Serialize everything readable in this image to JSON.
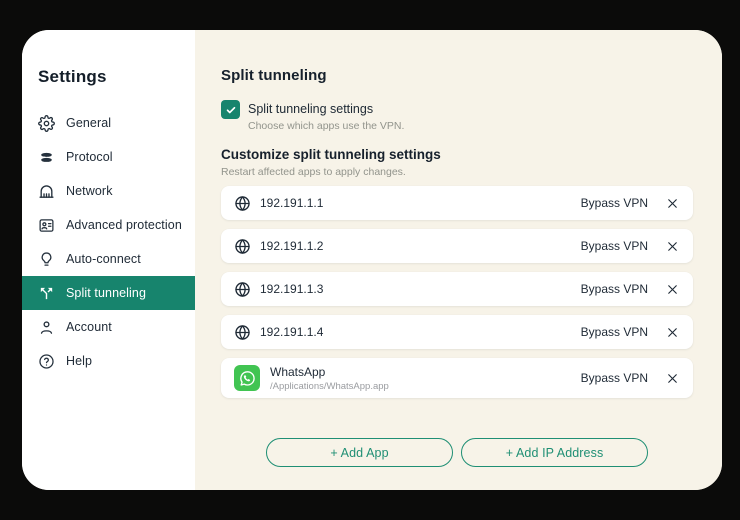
{
  "colors": {
    "frame_bg": "#0b0b0a",
    "sidebar_bg": "#ffffff",
    "main_bg": "#f7f3e8",
    "accent_green": "#17846d",
    "button_green": "#1f8f74",
    "whatsapp_green": "#41c452",
    "text_dark": "#1d2733",
    "text_gray": "#92948c"
  },
  "sidebar": {
    "title": "Settings",
    "items": [
      {
        "label": "General",
        "icon": "gear-icon",
        "selected": false
      },
      {
        "label": "Protocol",
        "icon": "protocol-icon",
        "selected": false
      },
      {
        "label": "Network",
        "icon": "building-icon",
        "selected": false
      },
      {
        "label": "Advanced protection",
        "icon": "badge-icon",
        "selected": false
      },
      {
        "label": "Auto-connect",
        "icon": "lightbulb-icon",
        "selected": false
      },
      {
        "label": "Split tunneling",
        "icon": "split-icon",
        "selected": true
      },
      {
        "label": "Account",
        "icon": "person-icon",
        "selected": false
      },
      {
        "label": "Help",
        "icon": "help-icon",
        "selected": false
      }
    ]
  },
  "main": {
    "title": "Split tunneling",
    "toggle": {
      "checked": true,
      "label": "Split tunneling settings",
      "description": "Choose which apps use the VPN."
    },
    "section_title": "Customize split tunneling settings",
    "section_description": "Restart affected apps to apply changes.",
    "rows": [
      {
        "icon": "globe-icon",
        "name": "192.191.1.1",
        "path": "",
        "mode": "Bypass VPN"
      },
      {
        "icon": "globe-icon",
        "name": "192.191.1.2",
        "path": "",
        "mode": "Bypass VPN"
      },
      {
        "icon": "globe-icon",
        "name": "192.191.1.3",
        "path": "",
        "mode": "Bypass VPN"
      },
      {
        "icon": "globe-icon",
        "name": "192.191.1.4",
        "path": "",
        "mode": "Bypass VPN"
      },
      {
        "icon": "whatsapp-icon",
        "name": "WhatsApp",
        "path": "/Applications/WhatsApp.app",
        "mode": "Bypass VPN"
      }
    ],
    "add_app_label": "+ Add App",
    "add_ip_label": "+ Add IP Address"
  }
}
